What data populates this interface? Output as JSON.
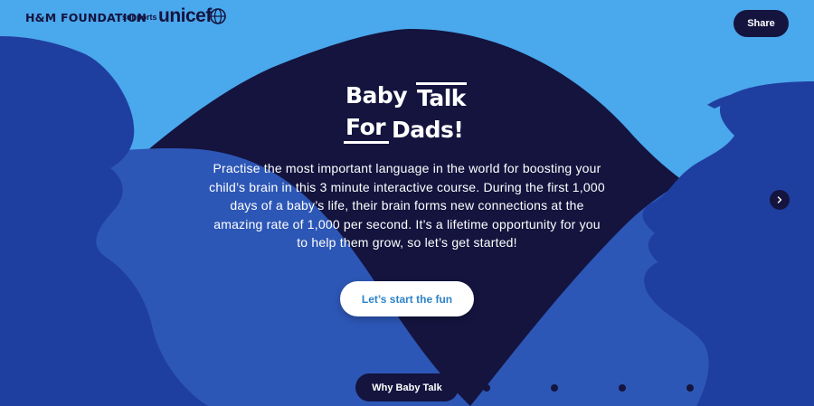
{
  "header": {
    "brand_hm": "H&M FOUNDATION",
    "brand_supports": "supports",
    "brand_unicef": "unicef",
    "share_label": "Share"
  },
  "logo": {
    "word1": "Baby",
    "word2": "Talk",
    "word3": "For",
    "word4": "Dads!"
  },
  "main": {
    "intro_text": "Practise the most important language in the world for boosting your child’s brain in this 3 minute interactive course. During the first 1,000 days of a baby’s life, their brain forms new connections at the amazing rate of 1,000 per second. It’s a lifetime opportunity for you to help them grow, so let’s get started!",
    "cta_label": "Let’s start the fun"
  },
  "navigation": {
    "current_step_label": "Why Baby Talk",
    "other_steps_count_visible": 4,
    "next_icon": "chevron-right-icon"
  },
  "colors": {
    "sky": "#4aa8ec",
    "navy": "#14143f",
    "silhouette": "#1f3fa0",
    "midground": "#2d57b6",
    "button_text": "#2d82c8"
  }
}
